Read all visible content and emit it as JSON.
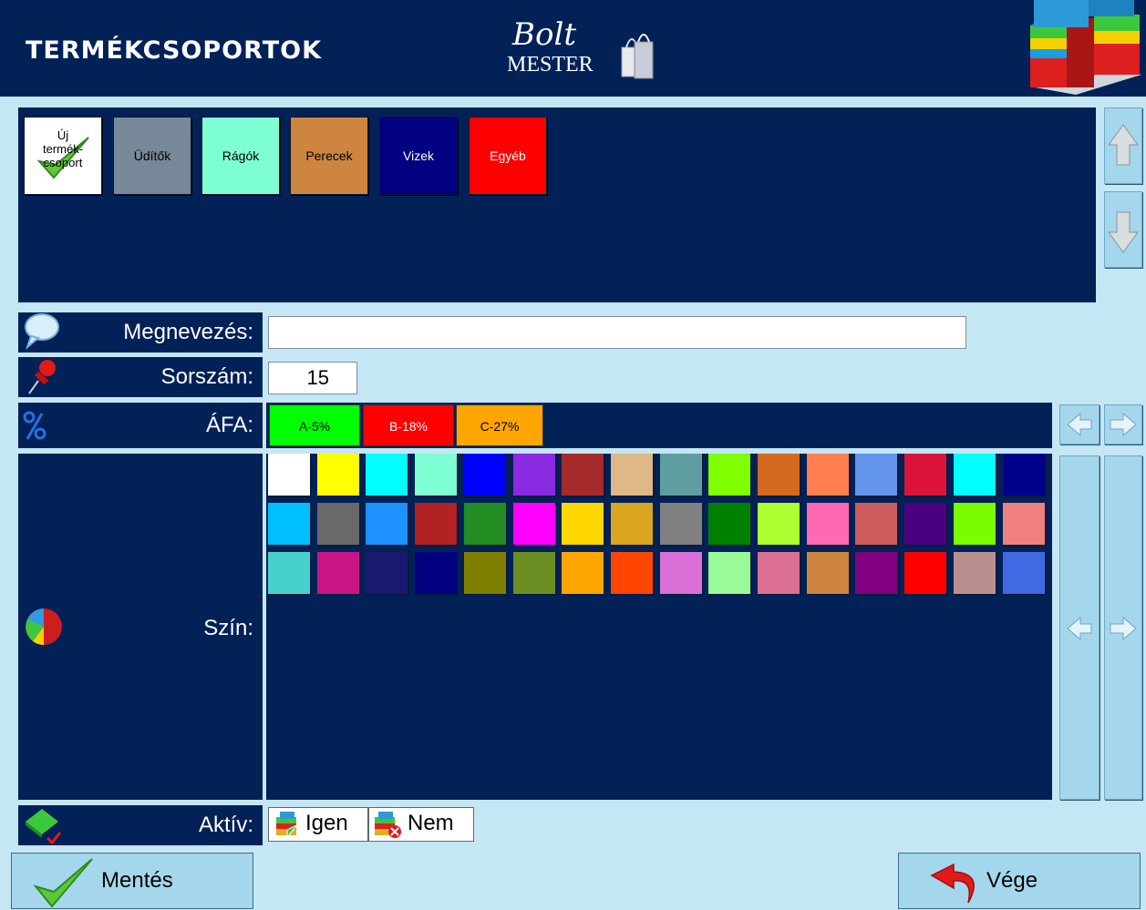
{
  "header": {
    "title": "TERMÉKCSOPORTOK",
    "logo_line1": "Bolt",
    "logo_line2": "MESTER"
  },
  "groups": [
    {
      "label": "Új termék-csoport",
      "line1": "Új",
      "line2": "termék-",
      "line3": "csoport",
      "bg": "#ffffff",
      "color": "#000000"
    },
    {
      "label": "Üdítők",
      "bg": "#778899",
      "color": "#000000"
    },
    {
      "label": "Rágók",
      "bg": "#7fffd4",
      "color": "#000000"
    },
    {
      "label": "Perecek",
      "bg": "#cd853f",
      "color": "#000000"
    },
    {
      "label": "Vizek",
      "bg": "#000080",
      "color": "#ffffff"
    },
    {
      "label": "Egyéb",
      "bg": "#ff0000",
      "color": "#ffffff"
    }
  ],
  "form": {
    "name_label": "Megnevezés:",
    "name_value": "",
    "order_label": "Sorszám:",
    "order_value": "15",
    "vat_label": "ÁFA:",
    "vat_options": [
      {
        "label": "A-5%",
        "bg": "#00ff00"
      },
      {
        "label": "B-18%",
        "bg": "#ff0000"
      },
      {
        "label": "C-27%",
        "bg": "#ffa500"
      }
    ],
    "color_label": "Szín:",
    "active_label": "Aktív:",
    "active_yes": "Igen",
    "active_no": "Nem"
  },
  "colors": [
    [
      "#ffffff",
      "#ffff00",
      "#00ffff",
      "#7fffd4",
      "#0000ff",
      "#8a2be2",
      "#a52a2a",
      "#deb887",
      "#5f9ea0",
      "#7fff00",
      "#d2691e",
      "#ff7f50",
      "#6495ed",
      "#dc143c",
      "#00ffff",
      "#00008b"
    ],
    [
      "#00bfff",
      "#696969",
      "#1e90ff",
      "#b22222",
      "#228b22",
      "#ff00ff",
      "#ffd700",
      "#daa520",
      "#808080",
      "#008000",
      "#adff2f",
      "#ff69b4",
      "#cd5c5c",
      "#4b0082",
      "#7cfc00",
      "#f08080"
    ],
    [
      "#48d1cc",
      "#c71585",
      "#191970",
      "#000080",
      "#808000",
      "#6b8e23",
      "#ffa500",
      "#ff4500",
      "#da70d6",
      "#98fb98",
      "#db7093",
      "#cd853f",
      "#800080",
      "#ff0000",
      "#bc8f8f",
      "#4169e1"
    ]
  ],
  "buttons": {
    "save": "Mentés",
    "exit": "Vége"
  }
}
